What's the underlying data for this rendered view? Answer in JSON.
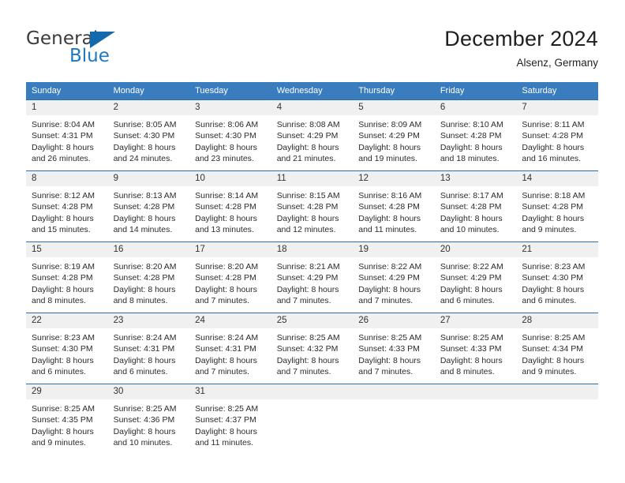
{
  "brand": {
    "name_part1": "General",
    "name_part2": "Blue"
  },
  "header": {
    "title": "December 2024",
    "subtitle": "Alsenz, Germany"
  },
  "colors": {
    "header_blue": "#3a7dbf",
    "row_border_blue": "#2f6da8",
    "daynum_band": "#f0f0f0",
    "brand_blue": "#1c78c0"
  },
  "weekday_headers": [
    "Sunday",
    "Monday",
    "Tuesday",
    "Wednesday",
    "Thursday",
    "Friday",
    "Saturday"
  ],
  "weeks": [
    [
      {
        "day": "1",
        "sunrise": "Sunrise: 8:04 AM",
        "sunset": "Sunset: 4:31 PM",
        "daylight1": "Daylight: 8 hours",
        "daylight2": "and 26 minutes."
      },
      {
        "day": "2",
        "sunrise": "Sunrise: 8:05 AM",
        "sunset": "Sunset: 4:30 PM",
        "daylight1": "Daylight: 8 hours",
        "daylight2": "and 24 minutes."
      },
      {
        "day": "3",
        "sunrise": "Sunrise: 8:06 AM",
        "sunset": "Sunset: 4:30 PM",
        "daylight1": "Daylight: 8 hours",
        "daylight2": "and 23 minutes."
      },
      {
        "day": "4",
        "sunrise": "Sunrise: 8:08 AM",
        "sunset": "Sunset: 4:29 PM",
        "daylight1": "Daylight: 8 hours",
        "daylight2": "and 21 minutes."
      },
      {
        "day": "5",
        "sunrise": "Sunrise: 8:09 AM",
        "sunset": "Sunset: 4:29 PM",
        "daylight1": "Daylight: 8 hours",
        "daylight2": "and 19 minutes."
      },
      {
        "day": "6",
        "sunrise": "Sunrise: 8:10 AM",
        "sunset": "Sunset: 4:28 PM",
        "daylight1": "Daylight: 8 hours",
        "daylight2": "and 18 minutes."
      },
      {
        "day": "7",
        "sunrise": "Sunrise: 8:11 AM",
        "sunset": "Sunset: 4:28 PM",
        "daylight1": "Daylight: 8 hours",
        "daylight2": "and 16 minutes."
      }
    ],
    [
      {
        "day": "8",
        "sunrise": "Sunrise: 8:12 AM",
        "sunset": "Sunset: 4:28 PM",
        "daylight1": "Daylight: 8 hours",
        "daylight2": "and 15 minutes."
      },
      {
        "day": "9",
        "sunrise": "Sunrise: 8:13 AM",
        "sunset": "Sunset: 4:28 PM",
        "daylight1": "Daylight: 8 hours",
        "daylight2": "and 14 minutes."
      },
      {
        "day": "10",
        "sunrise": "Sunrise: 8:14 AM",
        "sunset": "Sunset: 4:28 PM",
        "daylight1": "Daylight: 8 hours",
        "daylight2": "and 13 minutes."
      },
      {
        "day": "11",
        "sunrise": "Sunrise: 8:15 AM",
        "sunset": "Sunset: 4:28 PM",
        "daylight1": "Daylight: 8 hours",
        "daylight2": "and 12 minutes."
      },
      {
        "day": "12",
        "sunrise": "Sunrise: 8:16 AM",
        "sunset": "Sunset: 4:28 PM",
        "daylight1": "Daylight: 8 hours",
        "daylight2": "and 11 minutes."
      },
      {
        "day": "13",
        "sunrise": "Sunrise: 8:17 AM",
        "sunset": "Sunset: 4:28 PM",
        "daylight1": "Daylight: 8 hours",
        "daylight2": "and 10 minutes."
      },
      {
        "day": "14",
        "sunrise": "Sunrise: 8:18 AM",
        "sunset": "Sunset: 4:28 PM",
        "daylight1": "Daylight: 8 hours",
        "daylight2": "and 9 minutes."
      }
    ],
    [
      {
        "day": "15",
        "sunrise": "Sunrise: 8:19 AM",
        "sunset": "Sunset: 4:28 PM",
        "daylight1": "Daylight: 8 hours",
        "daylight2": "and 8 minutes."
      },
      {
        "day": "16",
        "sunrise": "Sunrise: 8:20 AM",
        "sunset": "Sunset: 4:28 PM",
        "daylight1": "Daylight: 8 hours",
        "daylight2": "and 8 minutes."
      },
      {
        "day": "17",
        "sunrise": "Sunrise: 8:20 AM",
        "sunset": "Sunset: 4:28 PM",
        "daylight1": "Daylight: 8 hours",
        "daylight2": "and 7 minutes."
      },
      {
        "day": "18",
        "sunrise": "Sunrise: 8:21 AM",
        "sunset": "Sunset: 4:29 PM",
        "daylight1": "Daylight: 8 hours",
        "daylight2": "and 7 minutes."
      },
      {
        "day": "19",
        "sunrise": "Sunrise: 8:22 AM",
        "sunset": "Sunset: 4:29 PM",
        "daylight1": "Daylight: 8 hours",
        "daylight2": "and 7 minutes."
      },
      {
        "day": "20",
        "sunrise": "Sunrise: 8:22 AM",
        "sunset": "Sunset: 4:29 PM",
        "daylight1": "Daylight: 8 hours",
        "daylight2": "and 6 minutes."
      },
      {
        "day": "21",
        "sunrise": "Sunrise: 8:23 AM",
        "sunset": "Sunset: 4:30 PM",
        "daylight1": "Daylight: 8 hours",
        "daylight2": "and 6 minutes."
      }
    ],
    [
      {
        "day": "22",
        "sunrise": "Sunrise: 8:23 AM",
        "sunset": "Sunset: 4:30 PM",
        "daylight1": "Daylight: 8 hours",
        "daylight2": "and 6 minutes."
      },
      {
        "day": "23",
        "sunrise": "Sunrise: 8:24 AM",
        "sunset": "Sunset: 4:31 PM",
        "daylight1": "Daylight: 8 hours",
        "daylight2": "and 6 minutes."
      },
      {
        "day": "24",
        "sunrise": "Sunrise: 8:24 AM",
        "sunset": "Sunset: 4:31 PM",
        "daylight1": "Daylight: 8 hours",
        "daylight2": "and 7 minutes."
      },
      {
        "day": "25",
        "sunrise": "Sunrise: 8:25 AM",
        "sunset": "Sunset: 4:32 PM",
        "daylight1": "Daylight: 8 hours",
        "daylight2": "and 7 minutes."
      },
      {
        "day": "26",
        "sunrise": "Sunrise: 8:25 AM",
        "sunset": "Sunset: 4:33 PM",
        "daylight1": "Daylight: 8 hours",
        "daylight2": "and 7 minutes."
      },
      {
        "day": "27",
        "sunrise": "Sunrise: 8:25 AM",
        "sunset": "Sunset: 4:33 PM",
        "daylight1": "Daylight: 8 hours",
        "daylight2": "and 8 minutes."
      },
      {
        "day": "28",
        "sunrise": "Sunrise: 8:25 AM",
        "sunset": "Sunset: 4:34 PM",
        "daylight1": "Daylight: 8 hours",
        "daylight2": "and 9 minutes."
      }
    ],
    [
      {
        "day": "29",
        "sunrise": "Sunrise: 8:25 AM",
        "sunset": "Sunset: 4:35 PM",
        "daylight1": "Daylight: 8 hours",
        "daylight2": "and 9 minutes."
      },
      {
        "day": "30",
        "sunrise": "Sunrise: 8:25 AM",
        "sunset": "Sunset: 4:36 PM",
        "daylight1": "Daylight: 8 hours",
        "daylight2": "and 10 minutes."
      },
      {
        "day": "31",
        "sunrise": "Sunrise: 8:25 AM",
        "sunset": "Sunset: 4:37 PM",
        "daylight1": "Daylight: 8 hours",
        "daylight2": "and 11 minutes."
      },
      {
        "day": "",
        "sunrise": "",
        "sunset": "",
        "daylight1": "",
        "daylight2": ""
      },
      {
        "day": "",
        "sunrise": "",
        "sunset": "",
        "daylight1": "",
        "daylight2": ""
      },
      {
        "day": "",
        "sunrise": "",
        "sunset": "",
        "daylight1": "",
        "daylight2": ""
      },
      {
        "day": "",
        "sunrise": "",
        "sunset": "",
        "daylight1": "",
        "daylight2": ""
      }
    ]
  ]
}
